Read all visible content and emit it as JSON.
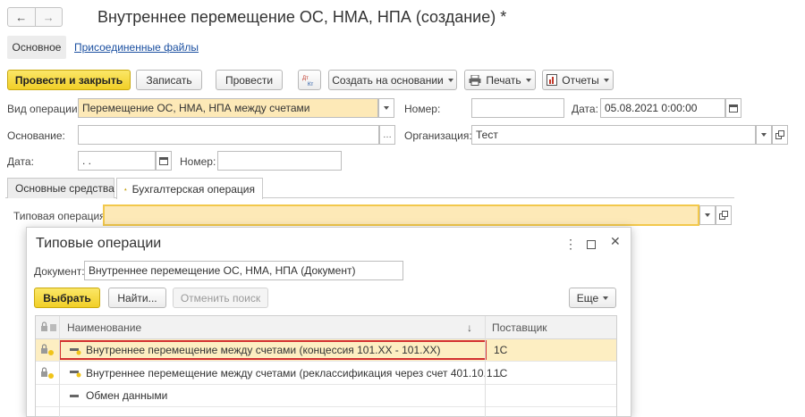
{
  "window": {
    "title": "Внутреннее перемещение ОС, НМА, НПА (создание) *",
    "nav": {
      "back_icon": "←",
      "forward_icon": "→"
    }
  },
  "subtabs": {
    "main": "Основное",
    "attached": "Присоединенные файлы"
  },
  "toolbar": {
    "post_close": "Провести и закрыть",
    "save": "Записать",
    "post": "Провести",
    "dt_kt": "Дт Кт",
    "create_based": "Создать на основании",
    "print": "Печать",
    "reports": "Отчеты"
  },
  "form": {
    "op_type_label": "Вид операции:",
    "op_type_value": "Перемещение ОС, НМА, НПА между счетами",
    "number_label": "Номер:",
    "number_value": "",
    "date_label": "Дата:",
    "date_value": "05.08.2021  0:00:00",
    "basis_label": "Основание:",
    "basis_value": "",
    "org_label": "Организация:",
    "org_value": "Тест",
    "date2_label": "Дата:",
    "date2_value": " .   .",
    "number2_label": "Номер:",
    "number2_value": ""
  },
  "tabs": {
    "fixed_assets": "Основные средства",
    "accounting_op": "Бухгалтерская операция"
  },
  "typical_op": {
    "label": "Типовая операция:",
    "value": ""
  },
  "dialog": {
    "title": "Типовые операции",
    "doc_label": "Документ:",
    "doc_value": "Внутреннее перемещение ОС, НМА, НПА (Документ)",
    "select": "Выбрать",
    "find": "Найти...",
    "cancel_search": "Отменить поиск",
    "more": "Еще",
    "columns": {
      "name": "Наименование",
      "supplier": "Поставщик",
      "sort_icon": "↓"
    },
    "rows": [
      {
        "name": "Внутреннее перемещение между счетами (концессия 101.XX - 101.XX)",
        "supplier": "1С"
      },
      {
        "name": "Внутреннее перемещение между счетами (реклассификация через счет 401.10.1...",
        "supplier": "1С"
      },
      {
        "name": "Обмен данными",
        "supplier": ""
      }
    ]
  }
}
